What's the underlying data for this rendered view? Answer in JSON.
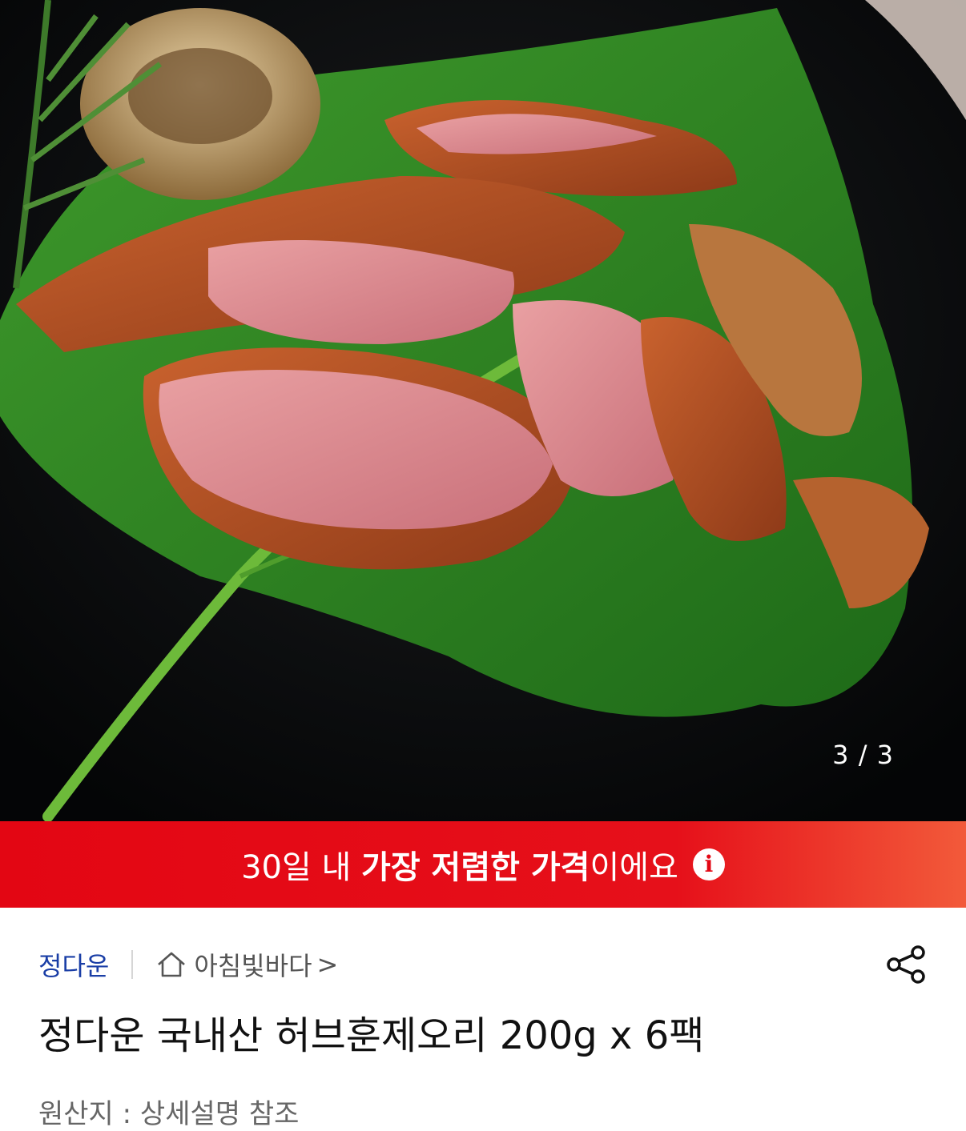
{
  "gallery": {
    "counter": "3 / 3"
  },
  "banner": {
    "prefix": "30일 내 ",
    "highlight": "가장 저렴한 가격",
    "suffix": "이에요",
    "icon": "info-icon"
  },
  "store": {
    "brand": "정다운",
    "shop_icon": "home-icon",
    "shop_name": "아침빛바다",
    "chevron": ">",
    "share_icon": "share-icon"
  },
  "product": {
    "title": "정다운 국내산 허브훈제오리 200g x 6팩",
    "origin": "원산지 : 상세설명 참조"
  },
  "colors": {
    "banner": "#e30613",
    "brand_link": "#1a3ea6"
  }
}
